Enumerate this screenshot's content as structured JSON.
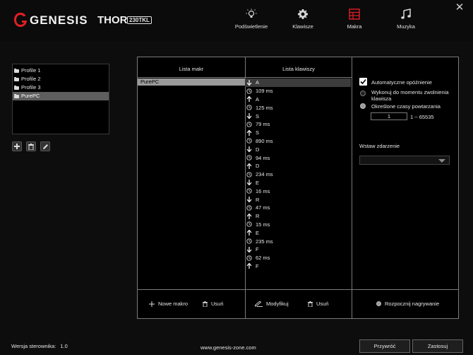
{
  "header": {
    "brand": "GENESIS",
    "product": "THOR",
    "product_model": "230TKL",
    "brand_color": "#e31e24"
  },
  "nav": {
    "tabs": [
      {
        "label": "Podświetlenie",
        "icon": "lightbulb-icon"
      },
      {
        "label": "Klawisze",
        "icon": "gear-icon"
      },
      {
        "label": "Makra",
        "icon": "macro-grid-icon",
        "active": true
      },
      {
        "label": "Muzyka",
        "icon": "music-note-icon"
      }
    ]
  },
  "profiles": {
    "items": [
      "Profile 1",
      "Profile 2",
      "Profile 3",
      "PurePC"
    ],
    "selected": "PurePC"
  },
  "macro_list": {
    "header": "Lista makr",
    "items": [
      "PurePC"
    ],
    "new_label": "Nowe makro",
    "delete_label": "Usuń"
  },
  "key_list": {
    "header": "Lista klawiszy",
    "items": [
      {
        "type": "down",
        "text": "A"
      },
      {
        "type": "delay",
        "text": "109 ms"
      },
      {
        "type": "up",
        "text": "A"
      },
      {
        "type": "delay",
        "text": "125 ms"
      },
      {
        "type": "down",
        "text": "S"
      },
      {
        "type": "delay",
        "text": "79 ms"
      },
      {
        "type": "up",
        "text": "S"
      },
      {
        "type": "delay",
        "text": "890 ms"
      },
      {
        "type": "down",
        "text": "D"
      },
      {
        "type": "delay",
        "text": "94 ms"
      },
      {
        "type": "up",
        "text": "D"
      },
      {
        "type": "delay",
        "text": "234 ms"
      },
      {
        "type": "down",
        "text": "E"
      },
      {
        "type": "delay",
        "text": "16 ms"
      },
      {
        "type": "down",
        "text": "R"
      },
      {
        "type": "delay",
        "text": "47 ms"
      },
      {
        "type": "up",
        "text": "R"
      },
      {
        "type": "delay",
        "text": "15 ms"
      },
      {
        "type": "up",
        "text": "E"
      },
      {
        "type": "delay",
        "text": "235 ms"
      },
      {
        "type": "down",
        "text": "F"
      },
      {
        "type": "delay",
        "text": "62 ms"
      },
      {
        "type": "up",
        "text": "F"
      }
    ],
    "modify_label": "Modyfikuj",
    "delete_label": "Usuń"
  },
  "settings": {
    "auto_delay_label": "Automatyczne opóźnienie",
    "auto_delay_checked": true,
    "repeat_until_release_label": "Wykonuj do momentu zwolnienia klawisza",
    "repeat_count_label": "Określone czasy powtarzania",
    "repeat_value": "1",
    "repeat_range": "1 ~ 65535",
    "insert_event_label": "Wstaw zdarzenie",
    "record_label": "Rozpocznij nagrywanie"
  },
  "footer": {
    "version_label": "Wersja sterownika:",
    "version_value": "1.0",
    "website": "www.genesis-zone.com",
    "apply_label": "Przywróć",
    "save_label": "Zastosuj"
  }
}
